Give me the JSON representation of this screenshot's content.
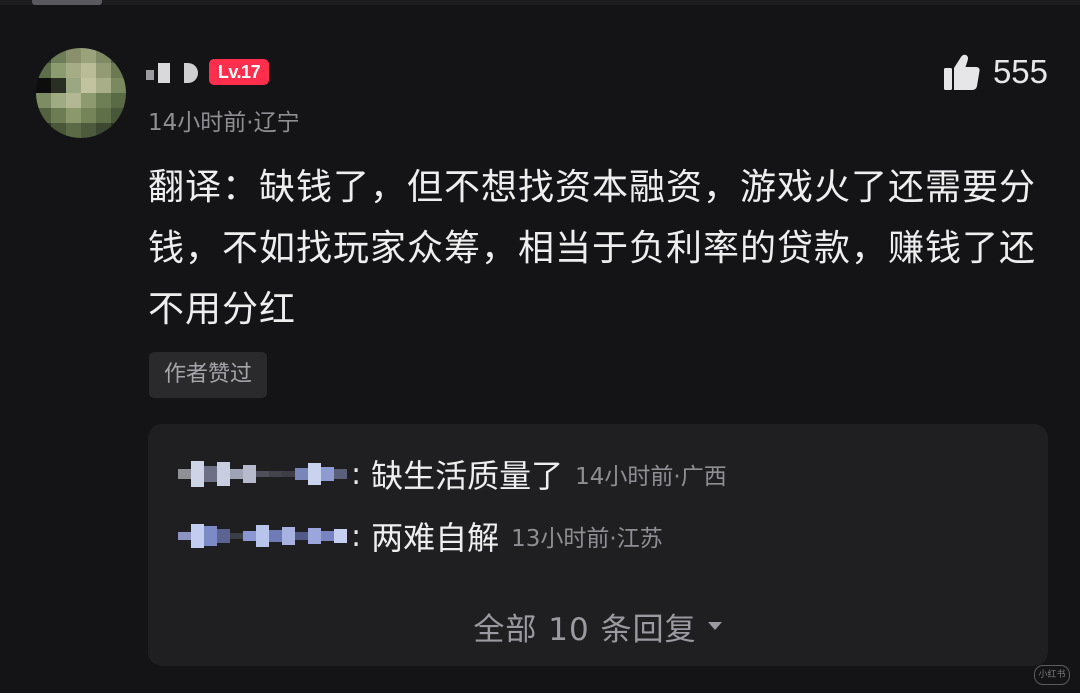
{
  "comment": {
    "level_badge": "Lv.17",
    "timestamp": "14小时前",
    "location": "辽宁",
    "like_count": "555",
    "text": "翻译：缺钱了，但不想找资本融资，游戏火了还需要分钱，不如找玩家众筹，相当于负利率的贷款，赚钱了还不用分红",
    "author_liked_label": "作者赞过"
  },
  "replies": [
    {
      "text": "缺生活质量了",
      "timestamp": "14小时前",
      "location": "广西"
    },
    {
      "text": "两难自解",
      "timestamp": "13小时前",
      "location": "江苏"
    }
  ],
  "view_all": "全部 10 条回复",
  "watermark": "小红书",
  "colors": {
    "background": "#141416",
    "level_badge": "#ff2e4d",
    "reply_panel": "#1f1f22",
    "secondary_text": "#8e8e93"
  },
  "icons": {
    "like": "thumbs-up-icon",
    "expand": "caret-down-icon"
  }
}
